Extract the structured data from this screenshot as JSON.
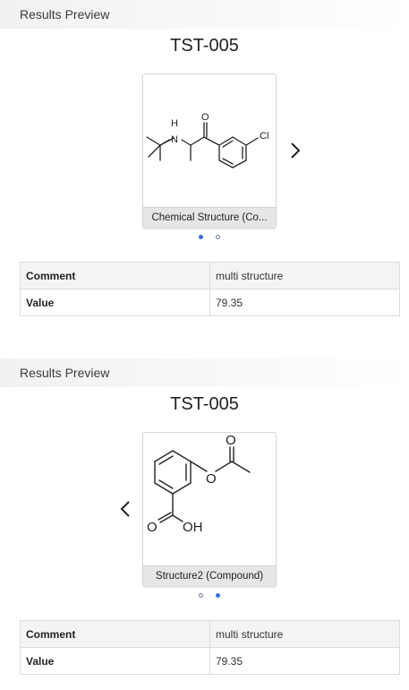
{
  "panels": [
    {
      "header": "Results Preview",
      "title": "TST-005",
      "card_caption": "Chemical Structure (Co...",
      "structure_atoms": {
        "nh": "H",
        "n": "N",
        "o": "O",
        "cl": "Cl"
      },
      "carousel": {
        "slide_index": 1,
        "slide_count": 2
      },
      "table": [
        {
          "label": "Comment",
          "value": "multi structure"
        },
        {
          "label": "Value",
          "value": "79.35"
        }
      ]
    },
    {
      "header": "Results Preview",
      "title": "TST-005",
      "card_caption": "Structure2 (Compound)",
      "structure_atoms": {
        "o_top": "O",
        "o_ester": "O",
        "o_acid": "O",
        "oh": "OH"
      },
      "carousel": {
        "slide_index": 2,
        "slide_count": 2
      },
      "table": [
        {
          "label": "Comment",
          "value": "multi structure"
        },
        {
          "label": "Value",
          "value": "79.35"
        }
      ]
    }
  ],
  "icons": {
    "next": "chevron-right-icon",
    "prev": "chevron-left-icon"
  },
  "colors": {
    "active_dot": "#3b6fd6",
    "header_bg": "#f1f1f1",
    "caption_bg": "#e6e6e6"
  }
}
